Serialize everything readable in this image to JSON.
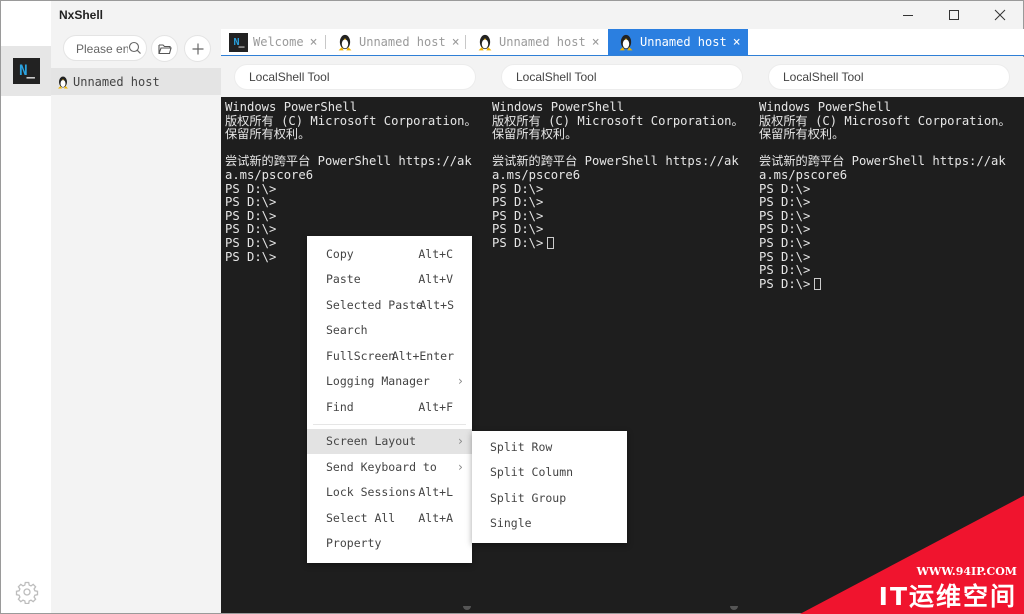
{
  "app": {
    "title": "NxShell"
  },
  "window_controls": {
    "minimize": "minimize-icon",
    "maximize": "maximize-icon",
    "close": "close-icon"
  },
  "activity_bar": {
    "logo_text": "N",
    "logo_cursor": "_",
    "settings_icon": "gear-icon"
  },
  "sidebar": {
    "search_placeholder": "Please enter",
    "search_value": "",
    "buttons": [
      {
        "icon": "folder-open-icon"
      },
      {
        "icon": "plus-icon"
      }
    ],
    "hosts": [
      {
        "label": "Unnamed host",
        "icon": "linux-penguin-icon"
      }
    ]
  },
  "tabs": [
    {
      "label": "Welcome",
      "icon": "nxshell-logo-icon",
      "active": false
    },
    {
      "label": "Unnamed host",
      "icon": "linux-penguin-icon",
      "active": false
    },
    {
      "label": "Unnamed host",
      "icon": "linux-penguin-icon",
      "active": false
    },
    {
      "label": "Unnamed host",
      "icon": "linux-penguin-icon",
      "active": true
    }
  ],
  "tab_close_glyph": "×",
  "panes": [
    {
      "tool_label": "LocalShell Tool",
      "lines": [
        "Windows PowerShell",
        "版权所有 (C) Microsoft Corporation。",
        "保留所有权利。",
        "",
        "尝试新的跨平台 PowerShell https://ak",
        "a.ms/pscore6",
        "PS D:\\>",
        "PS D:\\>",
        "PS D:\\>",
        "PS D:\\>",
        "PS D:\\>",
        "PS D:\\>"
      ],
      "cursor_on_last": false
    },
    {
      "tool_label": "LocalShell Tool",
      "lines": [
        "Windows PowerShell",
        "版权所有 (C) Microsoft Corporation。",
        "保留所有权利。",
        "",
        "尝试新的跨平台 PowerShell https://ak",
        "a.ms/pscore6",
        "PS D:\\>",
        "PS D:\\>",
        "PS D:\\>",
        "PS D:\\>",
        "PS D:\\>"
      ],
      "cursor_on_last": true
    },
    {
      "tool_label": "LocalShell Tool",
      "lines": [
        "Windows PowerShell",
        "版权所有 (C) Microsoft Corporation。",
        "保留所有权利。",
        "",
        "尝试新的跨平台 PowerShell https://ak",
        "a.ms/pscore6",
        "PS D:\\>",
        "PS D:\\>",
        "PS D:\\>",
        "PS D:\\>",
        "PS D:\\>",
        "PS D:\\>",
        "PS D:\\>",
        "PS D:\\>"
      ],
      "cursor_on_last": true
    }
  ],
  "context_menu": {
    "items": [
      {
        "label": "Copy",
        "shortcut": "Alt+C"
      },
      {
        "label": "Paste",
        "shortcut": "Alt+V"
      },
      {
        "label": "Selected Paste",
        "shortcut": "Alt+S"
      },
      {
        "label": "Search",
        "shortcut": ""
      },
      {
        "label": "FullScreen",
        "shortcut": "Alt+Enter"
      },
      {
        "label": "Logging Manager",
        "shortcut": "",
        "submenu": true
      },
      {
        "label": "Find",
        "shortcut": "Alt+F"
      }
    ],
    "items_after_separator": [
      {
        "label": "Screen Layout",
        "shortcut": "",
        "submenu": true,
        "highlighted": true
      },
      {
        "label": "Send Keyboard to",
        "shortcut": "",
        "submenu": true
      },
      {
        "label": "Lock Sessions",
        "shortcut": "Alt+L"
      },
      {
        "label": "Select All",
        "shortcut": "Alt+A"
      },
      {
        "label": "Property",
        "shortcut": ""
      }
    ],
    "submenu_arrow": "›"
  },
  "screen_layout_submenu": {
    "items": [
      {
        "label": "Split Row"
      },
      {
        "label": "Split Column"
      },
      {
        "label": "Split Group"
      },
      {
        "label": "Single"
      }
    ]
  },
  "watermark": {
    "url": "WWW.94IP.COM",
    "text": "IT运维空间",
    "color": "#f0142e"
  }
}
